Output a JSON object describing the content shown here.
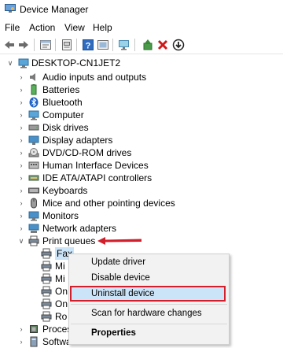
{
  "window": {
    "title": "Device Manager",
    "icon": "device-manager-icon"
  },
  "menu": [
    "File",
    "Action",
    "View",
    "Help"
  ],
  "toolbar": {
    "icons": [
      "back-arrow-icon",
      "forward-arrow-icon",
      "properties-icon",
      "show-hidden-icon",
      "help-icon",
      "scan-hardware-icon",
      "update-driver-icon",
      "uninstall-icon",
      "disable-device-icon"
    ]
  },
  "tree": {
    "root": "DESKTOP-CN1JET2",
    "categories": [
      {
        "label": "Audio inputs and outputs",
        "icon": "speaker-icon"
      },
      {
        "label": "Batteries",
        "icon": "battery-icon"
      },
      {
        "label": "Bluetooth",
        "icon": "bluetooth-icon"
      },
      {
        "label": "Computer",
        "icon": "computer-icon"
      },
      {
        "label": "Disk drives",
        "icon": "disk-drive-icon"
      },
      {
        "label": "Display adapters",
        "icon": "display-adapter-icon"
      },
      {
        "label": "DVD/CD-ROM drives",
        "icon": "dvd-icon"
      },
      {
        "label": "Human Interface Devices",
        "icon": "hid-icon"
      },
      {
        "label": "IDE ATA/ATAPI controllers",
        "icon": "ide-controller-icon"
      },
      {
        "label": "Keyboards",
        "icon": "keyboard-icon"
      },
      {
        "label": "Mice and other pointing devices",
        "icon": "mouse-icon"
      },
      {
        "label": "Monitors",
        "icon": "monitor-icon"
      },
      {
        "label": "Network adapters",
        "icon": "network-adapter-icon"
      },
      {
        "label": "Print queues",
        "icon": "printer-icon"
      }
    ],
    "print_children": [
      "Fax",
      "Mi",
      "Mi",
      "On",
      "On",
      "Ro"
    ],
    "after": [
      {
        "label": "Proces",
        "icon": "processor-icon"
      },
      {
        "label": "Softwa",
        "icon": "software-device-icon"
      }
    ]
  },
  "context_menu": {
    "items": [
      "Update driver",
      "Disable device",
      "Uninstall device",
      "Scan for hardware changes",
      "Properties"
    ],
    "highlighted": "Uninstall device"
  },
  "colors": {
    "highlight_border": "#d21f2b",
    "highlight_fill": "#cce4f7",
    "annotation_arrow": "#d21f2b"
  }
}
